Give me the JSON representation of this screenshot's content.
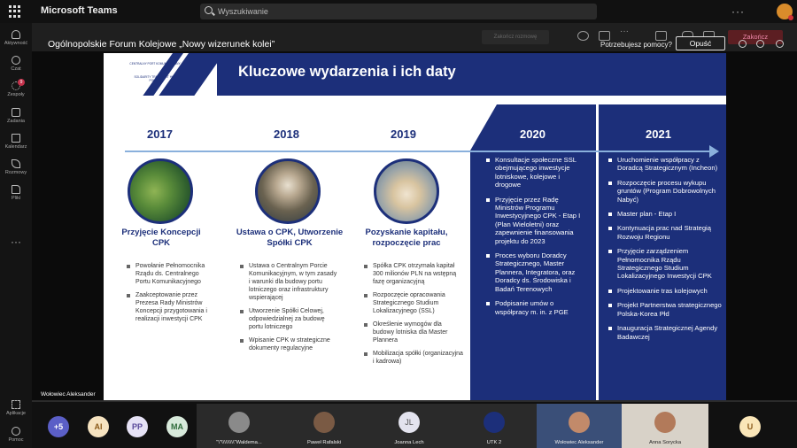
{
  "app": {
    "name": "Microsoft Teams"
  },
  "search": {
    "placeholder": "Wyszukiwanie"
  },
  "rail": {
    "items": [
      {
        "label": "Aktywność",
        "icon": "bell-icon"
      },
      {
        "label": "Czat",
        "icon": "chat-icon"
      },
      {
        "label": "Zespoły",
        "icon": "teams-icon",
        "badge": "9"
      },
      {
        "label": "Zadania",
        "icon": "tasks-icon"
      },
      {
        "label": "Kalendarz",
        "icon": "calendar-icon"
      },
      {
        "label": "Rozmowy",
        "icon": "calls-icon"
      },
      {
        "label": "Pliki",
        "icon": "files-icon"
      }
    ],
    "more": "···",
    "apps": "Aplikacje",
    "help": "Pomoc"
  },
  "meeting": {
    "title": "Ogólnopolskie Forum Kolejowe „Nowy wizerunek kolei”",
    "help_text": "Potrzebujesz pomocy?",
    "leave": "Opuść",
    "end": "Zakończ",
    "ghost": "Zakończ rozmowę"
  },
  "slide": {
    "title": "Kluczowe wydarzenia i ich daty",
    "logo": [
      "CENTRALNY PORT KOMUNIKACYJNY",
      "SOLIDARITY TRANSPORT HUB",
      "POLAND"
    ],
    "years": [
      "2017",
      "2018",
      "2019",
      "2020",
      "2021"
    ],
    "events": [
      "Przyjęcie Koncepcji CPK",
      "Ustawa o CPK, Utworzenie Spółki CPK",
      "Pozyskanie kapitału, rozpoczęcie prac"
    ],
    "col2017": [
      "Powołanie Pełnomocnika Rządu ds. Centralnego Portu Komunikacyjnego",
      "Zaakceptowanie przez Prezesa Rady Ministrów Koncepcji przygotowania i realizacji inwestycji CPK"
    ],
    "col2018": [
      "Ustawa o Centralnym Porcie Komunikacyjnym, w tym zasady i warunki dla budowy portu lotniczego oraz infrastruktury wspierającej",
      "Utworzenie Spółki Celowej, odpowiedzialnej za budowę portu lotniczego",
      "Wpisanie CPK w strategiczne dokumenty regulacyjne"
    ],
    "col2019": [
      "Spółka CPK otrzymała kapitał 300 milionów PLN na wstępną fazę organizacyjną",
      "Rozpoczęcie opracowania Strategicznego Studium Lokalizacyjnego (SSL)",
      "Określenie wymogów dla budowy lotniska dla Master Plannera",
      "Mobilizacja spółki (organizacyjna i kadrowa)"
    ],
    "col2020": [
      "Konsultacje społeczne SSL obejmującego inwestycje lotniskowe, kolejowe i drogowe",
      "Przyjęcie przez Radę Ministrów Programu Inwestycyjnego CPK - Etap I (Plan Wieloletni) oraz zapewnienie finansowania projektu do 2023",
      "Proces wyboru Doradcy Strategicznego, Master Plannera, Integratora, oraz Doradcy ds. Środowiska i Badań Terenowych",
      "Podpisanie umów o współpracy m. in. z PGE"
    ],
    "col2021": [
      "Uruchomienie współpracy z Doradcą Strategicznym (Incheon)",
      "Rozpoczęcie procesu wykupu gruntów (Program Dobrowolnych Nabyć)",
      "Master plan - Etap I",
      "Kontynuacja prac nad Strategią Rozwoju Regionu",
      "Przyjęcie zarządzeniem Pełnomocnika Rządu Strategicznego Studium Lokalizacyjnego Inwestycji CPK",
      "Projektowanie tras kolejowych",
      "Projekt Partnerstwa strategicznego Polska-Korea Płd",
      "Inauguracja Strategicznej Agendy Badawczej"
    ]
  },
  "speaker": "Wołowiec Aleksander",
  "participants": {
    "more": "+5",
    "avatars": [
      "AI",
      "PP",
      "MA"
    ],
    "tiles": [
      {
        "name": "\"\\\"\\\\\\\\\\\\\\\\\\\"Waldema...",
        "avatar": ""
      },
      {
        "name": "Paweł Rafalski",
        "avatar": ""
      },
      {
        "name": "Joanna Lech",
        "avatar": "JL"
      },
      {
        "name": "UTK 2",
        "avatar": ""
      },
      {
        "name": "Wołowiec Aleksander",
        "avatar": ""
      },
      {
        "name": "Anna Sorycka",
        "avatar": ""
      }
    ],
    "last": "U"
  },
  "colors": {
    "slide_blue": "#1c2f7a",
    "axis": "#8ab0dc",
    "end_red": "#5c1e22"
  }
}
